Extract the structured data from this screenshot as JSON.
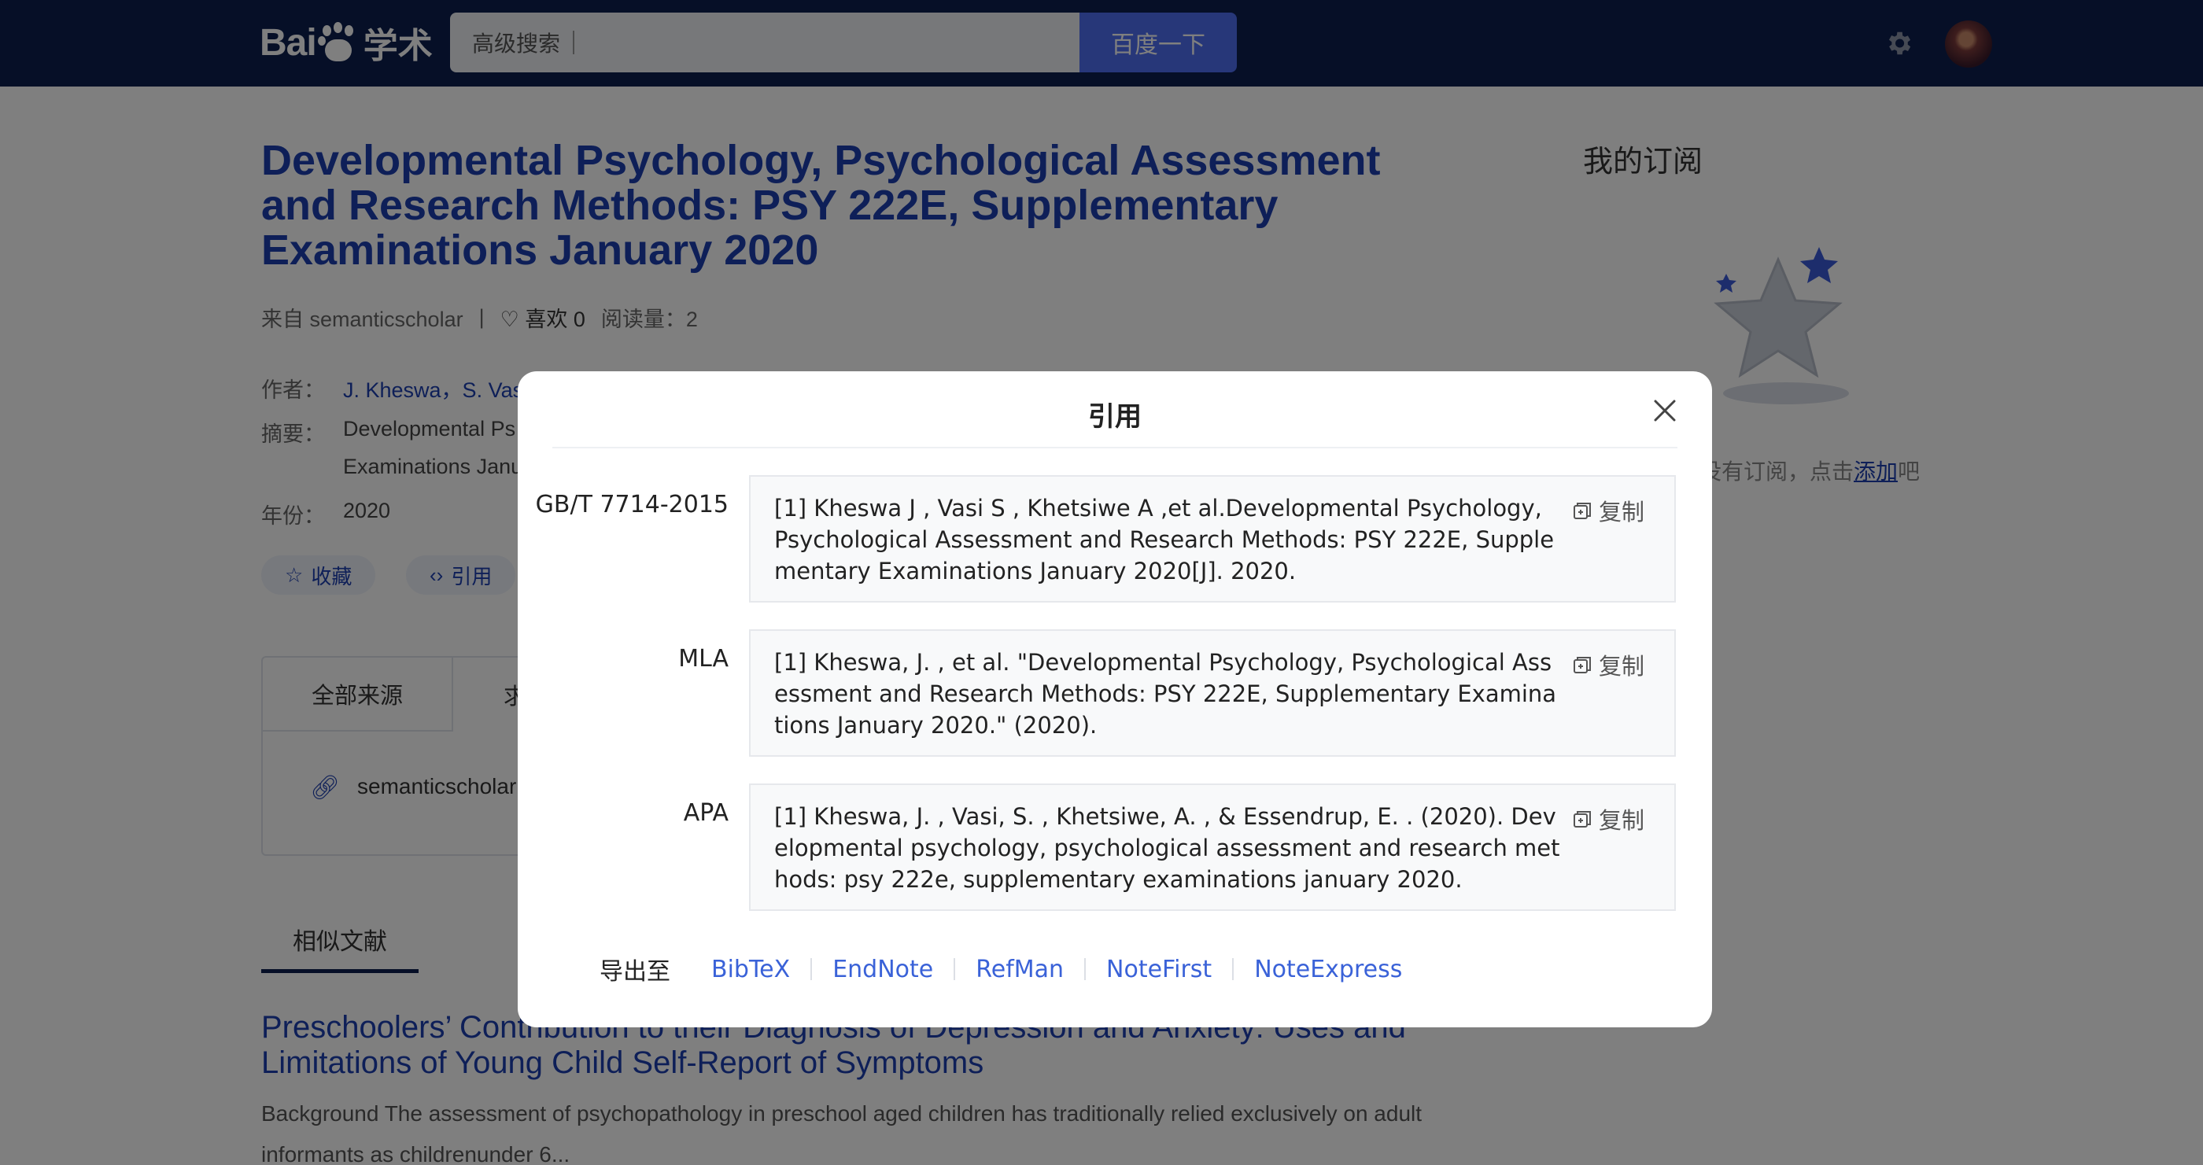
{
  "header": {
    "logo_text": "Bai",
    "logo_suffix": "学术",
    "search_placeholder": "高级搜索",
    "search_button": "百度一下",
    "settings_icon": "gear-icon",
    "avatar_icon": "user-avatar"
  },
  "paper": {
    "title": "Developmental Psychology, Psychological Assessment and Research Methods: PSY 222E, Supplementary Examinations January 2020",
    "source": "来自 semanticscholar",
    "likes": "♡ 喜欢 0",
    "reads": "阅读量：2",
    "author_label": "作者：",
    "authors": "J. Kheswa，S. Vasi",
    "abstract_label": "摘要：",
    "abstract_line1": "Developmental Ps",
    "abstract_line2": "Examinations Janu",
    "year_label": "年份：",
    "year": "2020",
    "collect_button": "收藏",
    "cite_button": "引用"
  },
  "sources": {
    "tab_all": "全部来源",
    "tab_2": "求",
    "items": [
      "semanticscholar"
    ]
  },
  "similar": {
    "tab_label": "相似文献",
    "title": "Preschoolers’   Contribution to their Diagnosis of Depression and Anxiety: Uses and Limitations of Young Child Self-Report of Symptoms",
    "abstract": "Background  The assessment of psychopathology in preschool aged children has traditionally relied exclusively on adult informants as childrenunder 6..."
  },
  "sidebar": {
    "title": "我的订阅",
    "empty_tip": "没有订阅，点击",
    "add_link": "添加",
    "empty_tip_suffix": "吧"
  },
  "modal": {
    "title": "引用",
    "copy_label": "复制",
    "citations": [
      {
        "format": "GB/T 7714-2015",
        "text": "[1] Kheswa J , Vasi S , Khetsiwe A ,et al.Developmental Psychology, Psychological Assessment and Research Methods: PSY 222E, Supplementary Examinations January 2020[J]. 2020."
      },
      {
        "format": "MLA",
        "text": "[1] Kheswa, J. , et al. \"Developmental Psychology, Psychological Assessment and Research Methods: PSY 222E, Supplementary Examinations January 2020.\" (2020)."
      },
      {
        "format": "APA",
        "text": "[1] Kheswa, J. , Vasi, S. , Khetsiwe, A. , & Essendrup, E. . (2020). Developmental psychology, psychological assessment and research methods: psy 222e, supplementary examinations january 2020."
      }
    ],
    "export_label": "导出至",
    "export_formats": [
      "BibTeX",
      "EndNote",
      "RefMan",
      "NoteFirst",
      "NoteExpress"
    ]
  }
}
